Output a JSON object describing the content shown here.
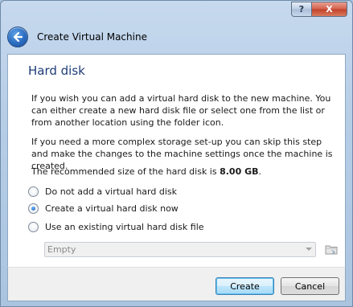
{
  "window": {
    "title": "Create Virtual Machine",
    "help_label": "?",
    "close_label": "X"
  },
  "page": {
    "heading": "Hard disk",
    "para1": "If you wish you can add a virtual hard disk to the new machine. You can either create a new hard disk file or select one from the list or from another location using the folder icon.",
    "para2": "If you need a more complex storage set-up you can skip this step and make the changes to the machine settings once the machine is created.",
    "para3_prefix": "The recommended size of the hard disk is ",
    "para3_size": "8.00 GB",
    "para3_suffix": "."
  },
  "options": [
    {
      "label": "Do not add a virtual hard disk",
      "checked": false
    },
    {
      "label": "Create a virtual hard disk now",
      "checked": true
    },
    {
      "label": "Use an existing virtual hard disk file",
      "checked": false
    }
  ],
  "disk_select": {
    "value": "Empty",
    "enabled": false
  },
  "buttons": {
    "create": "Create",
    "cancel": "Cancel"
  },
  "icons": {
    "back": "back-arrow-icon",
    "folder": "folder-icon"
  },
  "colors": {
    "heading": "#1f3c78",
    "frame": "#b6cde6",
    "default_button_border": "#3c7fb1"
  }
}
